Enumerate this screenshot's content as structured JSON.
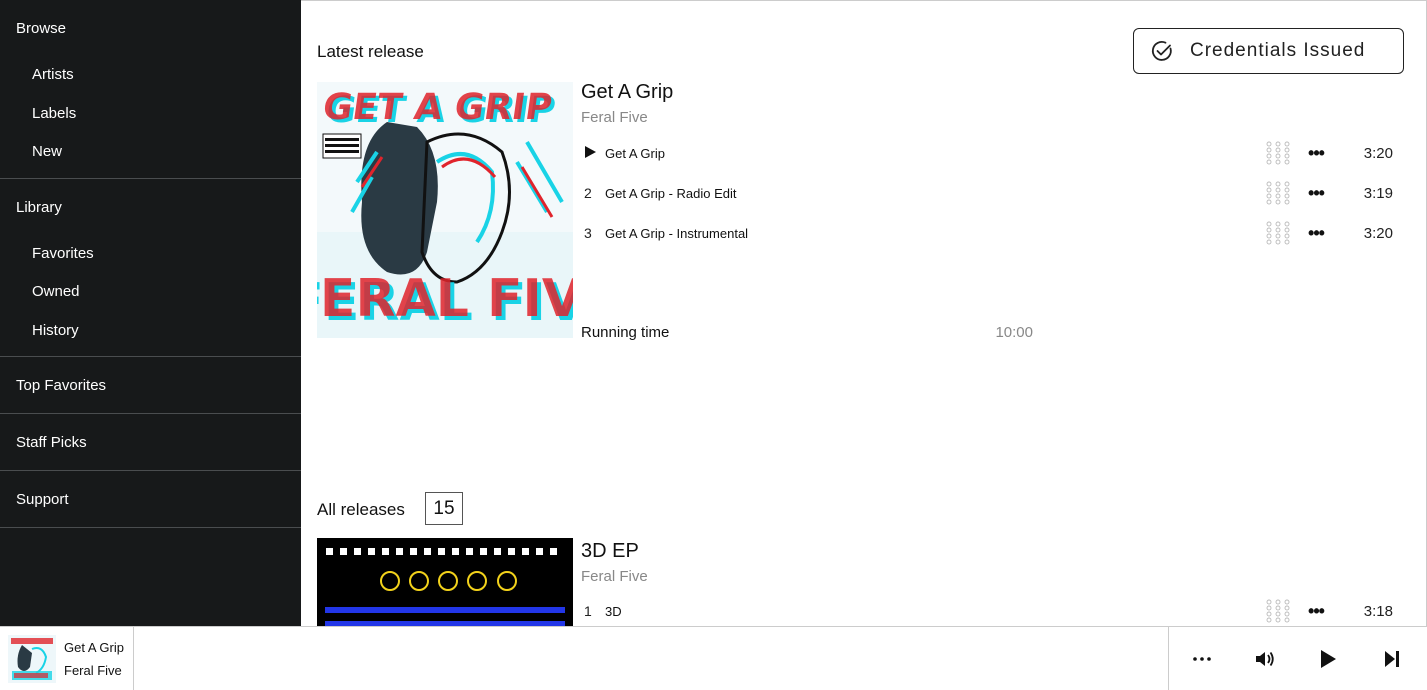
{
  "sidebar": {
    "browse": {
      "label": "Browse",
      "items": [
        "Artists",
        "Labels",
        "New"
      ]
    },
    "library": {
      "label": "Library",
      "items": [
        "Favorites",
        "Owned",
        "History"
      ]
    },
    "top_favorites": "Top Favorites",
    "staff_picks": "Staff Picks",
    "support": "Support"
  },
  "latest": {
    "section_title": "Latest release",
    "credentials_button": "Credentials Issued",
    "title": "Get A Grip",
    "artist": "Feral Five",
    "cover_text_top": "GET A GRIP",
    "cover_text_bottom": "FERAL FIVE",
    "tracks": [
      {
        "num": "",
        "title": "Get A Grip",
        "duration": "3:20",
        "playing_icon": "play-icon"
      },
      {
        "num": "2",
        "title": "Get A Grip - Radio Edit",
        "duration": "3:19"
      },
      {
        "num": "3",
        "title": "Get A Grip - Instrumental",
        "duration": "3:20"
      }
    ],
    "running_time_label": "Running time",
    "running_time_value": "10:00"
  },
  "all_releases": {
    "section_title": "All releases",
    "count": "15",
    "first": {
      "title": "3D EP",
      "artist": "Feral Five",
      "tracks": [
        {
          "num": "1",
          "title": "3D",
          "duration": "3:18"
        }
      ]
    }
  },
  "player": {
    "title": "Get A Grip",
    "artist": "Feral Five",
    "icons": [
      "more-icon",
      "volume-icon",
      "play-icon",
      "skip-next-icon"
    ]
  },
  "colors": {
    "sidebar_bg": "#17191a",
    "cover_red": "#e0242c",
    "cover_cyan": "#19d3e6",
    "ep_yellow": "#f2d21b",
    "ep_blue": "#2236e8"
  }
}
